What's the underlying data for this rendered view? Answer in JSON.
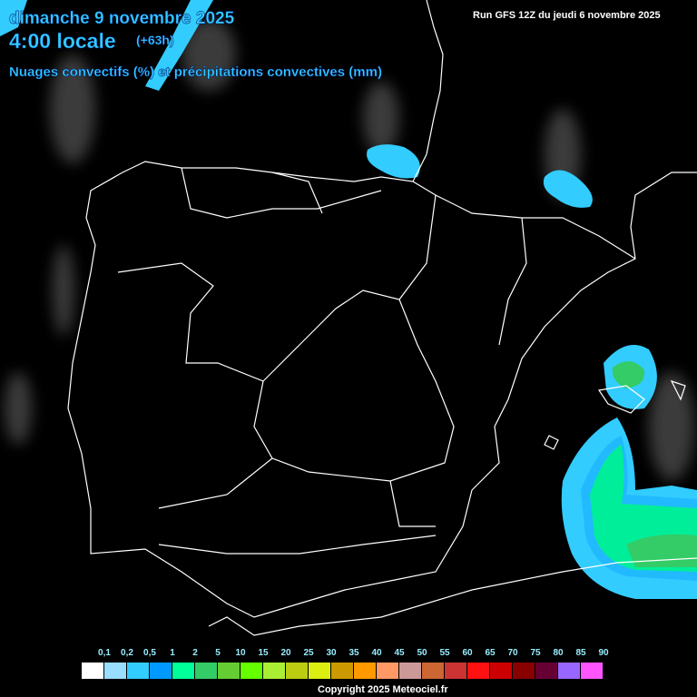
{
  "header": {
    "date": "dimanche 9 novembre 2025",
    "time": "4:00 locale",
    "offset": "(+63h)",
    "title": "Nuages convectifs (%) et précipitations convectives (mm)",
    "run": "Run GFS 12Z du jeudi 6 novembre 2025"
  },
  "legend": {
    "labels": [
      "0,1",
      "0,2",
      "0,5",
      "1",
      "2",
      "5",
      "10",
      "15",
      "20",
      "25",
      "30",
      "35",
      "40",
      "45",
      "50",
      "55",
      "60",
      "65",
      "70",
      "75",
      "80",
      "85",
      "90"
    ],
    "colors": [
      "#ffffff",
      "#99ddff",
      "#33ccff",
      "#0099ff",
      "#00ff99",
      "#33cc66",
      "#66cc33",
      "#66ff00",
      "#aaee33",
      "#bbcc11",
      "#ddee11",
      "#cc9900",
      "#ff9900",
      "#ff9966",
      "#cc9999",
      "#cc6633",
      "#cc3333",
      "#ff1111",
      "#cc0000",
      "#880000",
      "#660033",
      "#9966ff",
      "#ff55ff"
    ]
  },
  "copyright": "Copyright 2025 Meteociel.fr"
}
